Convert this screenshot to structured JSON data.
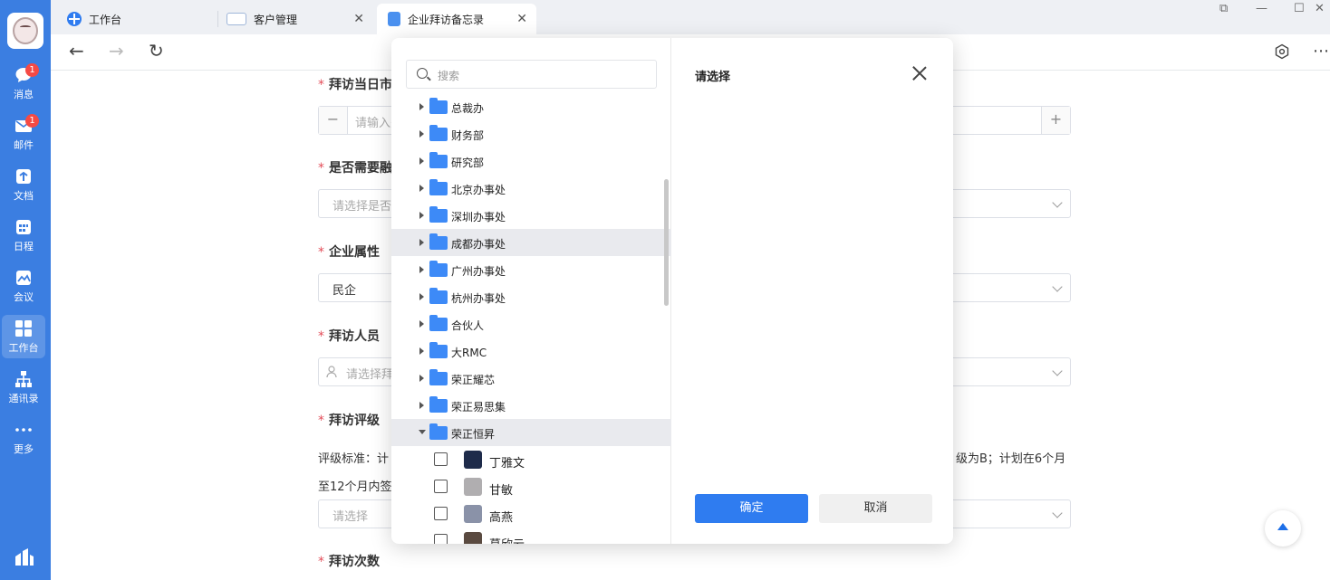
{
  "sidebar": {
    "items": [
      {
        "label": "消息",
        "badge": "1"
      },
      {
        "label": "邮件",
        "badge": "1"
      },
      {
        "label": "文档"
      },
      {
        "label": "日程"
      },
      {
        "label": "会议"
      },
      {
        "label": "工作台",
        "active": true
      },
      {
        "label": "通讯录"
      },
      {
        "label": "更多"
      }
    ]
  },
  "tabs": [
    {
      "label": "工作台"
    },
    {
      "label": "客户管理"
    },
    {
      "label": "企业拜访备忘录",
      "active": true
    }
  ],
  "form": {
    "fields": [
      {
        "label": "拜访当日市值",
        "placeholder": "请输入关",
        "minus": "−",
        "plus": "+"
      },
      {
        "label": "是否需要融资",
        "placeholder": "请选择是否"
      },
      {
        "label": "企业属性",
        "value": "民企"
      },
      {
        "label": "拜访人员",
        "placeholder": "请选择拜"
      },
      {
        "label": "拜访评级"
      },
      {
        "label": "拜访次数"
      }
    ],
    "rating_text_line1_left": "评级标准：计",
    "rating_text_line1_right": "级为B；计划在6个月",
    "rating_text_line2": "至12个月内签",
    "rating_placeholder": "请选择"
  },
  "modal": {
    "search_placeholder": "搜索",
    "title": "请选择",
    "ok_label": "确定",
    "cancel_label": "取消",
    "tree": [
      {
        "name": "总裁办",
        "type": "folder"
      },
      {
        "name": "财务部",
        "type": "folder"
      },
      {
        "name": "研究部",
        "type": "folder"
      },
      {
        "name": "北京办事处",
        "type": "folder"
      },
      {
        "name": "深圳办事处",
        "type": "folder"
      },
      {
        "name": "成都办事处",
        "type": "folder",
        "hover": true
      },
      {
        "name": "广州办事处",
        "type": "folder"
      },
      {
        "name": "杭州办事处",
        "type": "folder"
      },
      {
        "name": "合伙人",
        "type": "folder"
      },
      {
        "name": "大RMC",
        "type": "folder"
      },
      {
        "name": "荣正耀芯",
        "type": "folder"
      },
      {
        "name": "荣正易思集",
        "type": "folder"
      },
      {
        "name": "荣正恒昇",
        "type": "folder",
        "expanded": true
      },
      {
        "name": "丁雅文",
        "type": "person"
      },
      {
        "name": "甘敏",
        "type": "person"
      },
      {
        "name": "高燕",
        "type": "person"
      },
      {
        "name": "葛欣云",
        "type": "person"
      }
    ]
  },
  "colors": {
    "sidebar": "#3b7ee1",
    "primary": "#2f7cf0",
    "folder": "#3d8af7",
    "required": "#e34d59"
  }
}
